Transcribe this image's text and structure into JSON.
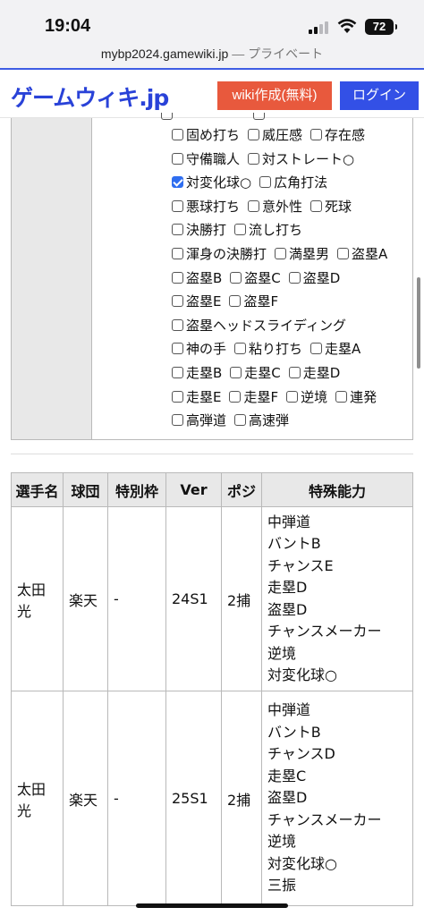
{
  "status": {
    "time": "19:04",
    "battery": "72"
  },
  "browser": {
    "url": "mybp2024.gamewiki.jp",
    "separator": "—",
    "mode": "プライベート"
  },
  "site": {
    "logo": "ゲームウィキ.jp",
    "create_wiki": "wiki作成(無料)",
    "login": "ログイン"
  },
  "filter": {
    "rows": [
      [
        {
          "label": "固め打ち",
          "checked": false
        },
        {
          "label": "威圧感",
          "checked": false
        },
        {
          "label": "存在感",
          "checked": false
        }
      ],
      [
        {
          "label": "守備職人",
          "checked": false
        },
        {
          "label": "対ストレート○",
          "checked": false
        }
      ],
      [
        {
          "label": "対変化球○",
          "checked": true
        },
        {
          "label": "広角打法",
          "checked": false
        }
      ],
      [
        {
          "label": "悪球打ち",
          "checked": false
        },
        {
          "label": "意外性",
          "checked": false
        },
        {
          "label": "死球",
          "checked": false
        }
      ],
      [
        {
          "label": "決勝打",
          "checked": false
        },
        {
          "label": "流し打ち",
          "checked": false
        }
      ],
      [
        {
          "label": "渾身の決勝打",
          "checked": false
        },
        {
          "label": "満塁男",
          "checked": false
        },
        {
          "label": "盗塁A",
          "checked": false
        }
      ],
      [
        {
          "label": "盗塁B",
          "checked": false
        },
        {
          "label": "盗塁C",
          "checked": false
        },
        {
          "label": "盗塁D",
          "checked": false
        }
      ],
      [
        {
          "label": "盗塁E",
          "checked": false
        },
        {
          "label": "盗塁F",
          "checked": false
        }
      ],
      [
        {
          "label": "盗塁ヘッドスライディング",
          "checked": false
        }
      ],
      [
        {
          "label": "神の手",
          "checked": false
        },
        {
          "label": "粘り打ち",
          "checked": false
        },
        {
          "label": "走塁A",
          "checked": false
        }
      ],
      [
        {
          "label": "走塁B",
          "checked": false
        },
        {
          "label": "走塁C",
          "checked": false
        },
        {
          "label": "走塁D",
          "checked": false
        }
      ],
      [
        {
          "label": "走塁E",
          "checked": false
        },
        {
          "label": "走塁F",
          "checked": false
        },
        {
          "label": "逆境",
          "checked": false
        },
        {
          "label": "連発",
          "checked": false
        }
      ],
      [
        {
          "label": "高弾道",
          "checked": false
        },
        {
          "label": "高速弾",
          "checked": false
        }
      ]
    ]
  },
  "table": {
    "headers": [
      "選手名",
      "球団",
      "特別枠",
      "Ver",
      "ポジ",
      "特殊能力"
    ],
    "rows": [
      {
        "name": "太田 光",
        "team": "楽天",
        "special": "-",
        "ver": "24S1",
        "pos": "2捕",
        "abilities": [
          "中弾道",
          "バントB",
          "チャンスE",
          "走塁D",
          "盗塁D",
          "チャンスメーカー",
          "逆境",
          "対変化球○"
        ]
      },
      {
        "name": "太田 光",
        "team": "楽天",
        "special": "-",
        "ver": "25S1",
        "pos": "2捕",
        "abilities": [
          "中弾道",
          "バントB",
          "チャンスD",
          "走塁C",
          "盗塁D",
          "チャンスメーカー",
          "逆境",
          "対変化球○",
          "三振"
        ]
      }
    ]
  }
}
